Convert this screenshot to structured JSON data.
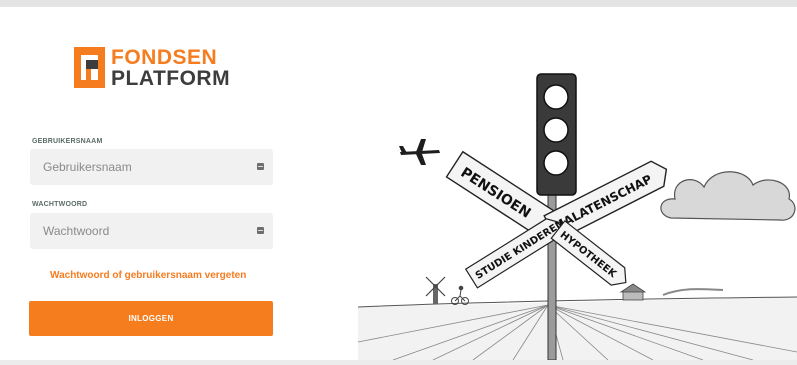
{
  "logo": {
    "line1": "FONDSEN",
    "line2": "PLATFORM"
  },
  "login": {
    "username_label": "GEBRUIKERSNAAM",
    "username_placeholder": "Gebruikersnaam",
    "password_label": "WACHTWOORD",
    "password_placeholder": "Wachtwoord",
    "forgot_link": "Wachtwoord of gebruikersnaam vergeten",
    "submit_label": "INLOGGEN"
  },
  "illustration": {
    "signs": [
      "PENSIOEN",
      "NALATENSCHAP",
      "STUDIE KINDEREN",
      "HYPOTHEEK"
    ]
  },
  "colors": {
    "accent": "#f57d1e",
    "logo_dark": "#3d3d3d",
    "input_bg": "#f1f1f1"
  },
  "icons": [
    "logo-mark-icon",
    "key-icon",
    "airplane-icon",
    "traffic-light-icon",
    "windmill-icon",
    "cyclist-icon"
  ]
}
